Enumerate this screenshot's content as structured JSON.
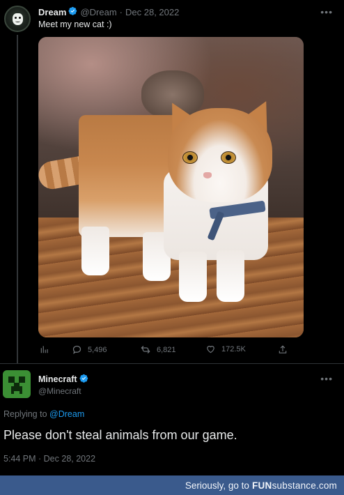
{
  "tweet": {
    "author_name": "Dream",
    "author_handle": "@Dream",
    "date": "Dec 28, 2022",
    "text": "Meet my new cat :)",
    "stats": {
      "replies": "5,496",
      "retweets": "6,821",
      "likes": "172.5K"
    }
  },
  "reply": {
    "author_name": "Minecraft",
    "author_handle": "@Minecraft",
    "replying_prefix": "Replying to",
    "replying_to": "@Dream",
    "text": "Please don't steal animals from our game.",
    "timestamp": "5:44 PM · Dec 28, 2022"
  },
  "footer": {
    "text": "Seriously, go to",
    "brand_a": "FUN",
    "brand_b": "substance",
    "brand_c": ".com"
  },
  "colors": {
    "background": "#000000",
    "link": "#1d9bf0",
    "verified": "#1d9bf0",
    "muted": "#71767b",
    "footer": "#3a5a8c"
  },
  "icons": [
    "avatar-dream",
    "verified-badge-icon",
    "more-icon",
    "analytics-icon",
    "reply-icon",
    "retweet-icon",
    "like-icon",
    "share-icon",
    "avatar-minecraft-creeper"
  ]
}
